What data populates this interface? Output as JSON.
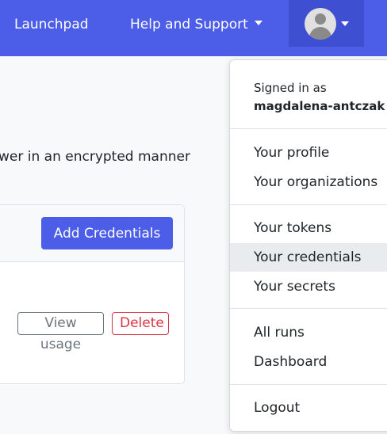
{
  "navbar": {
    "launchpad": "Launchpad",
    "help_support": "Help and Support",
    "brand_color": "#4c5ee8"
  },
  "main": {
    "description": "wer in an encrypted manner",
    "add_credentials_label": "Add Credentials",
    "view_usage_label": "View usage",
    "delete_label": "Delete"
  },
  "user_menu": {
    "signed_in_as_label": "Signed in as",
    "username": "magdalena-antczak",
    "items": [
      {
        "label": "Your profile"
      },
      {
        "label": "Your organizations"
      },
      {
        "label": "Your tokens"
      },
      {
        "label": "Your credentials",
        "active": true
      },
      {
        "label": "Your secrets"
      },
      {
        "label": "All runs"
      },
      {
        "label": "Dashboard"
      },
      {
        "label": "Logout"
      }
    ]
  },
  "icons": {
    "avatar": "user-avatar-icon",
    "caret": "chevron-down-icon"
  }
}
